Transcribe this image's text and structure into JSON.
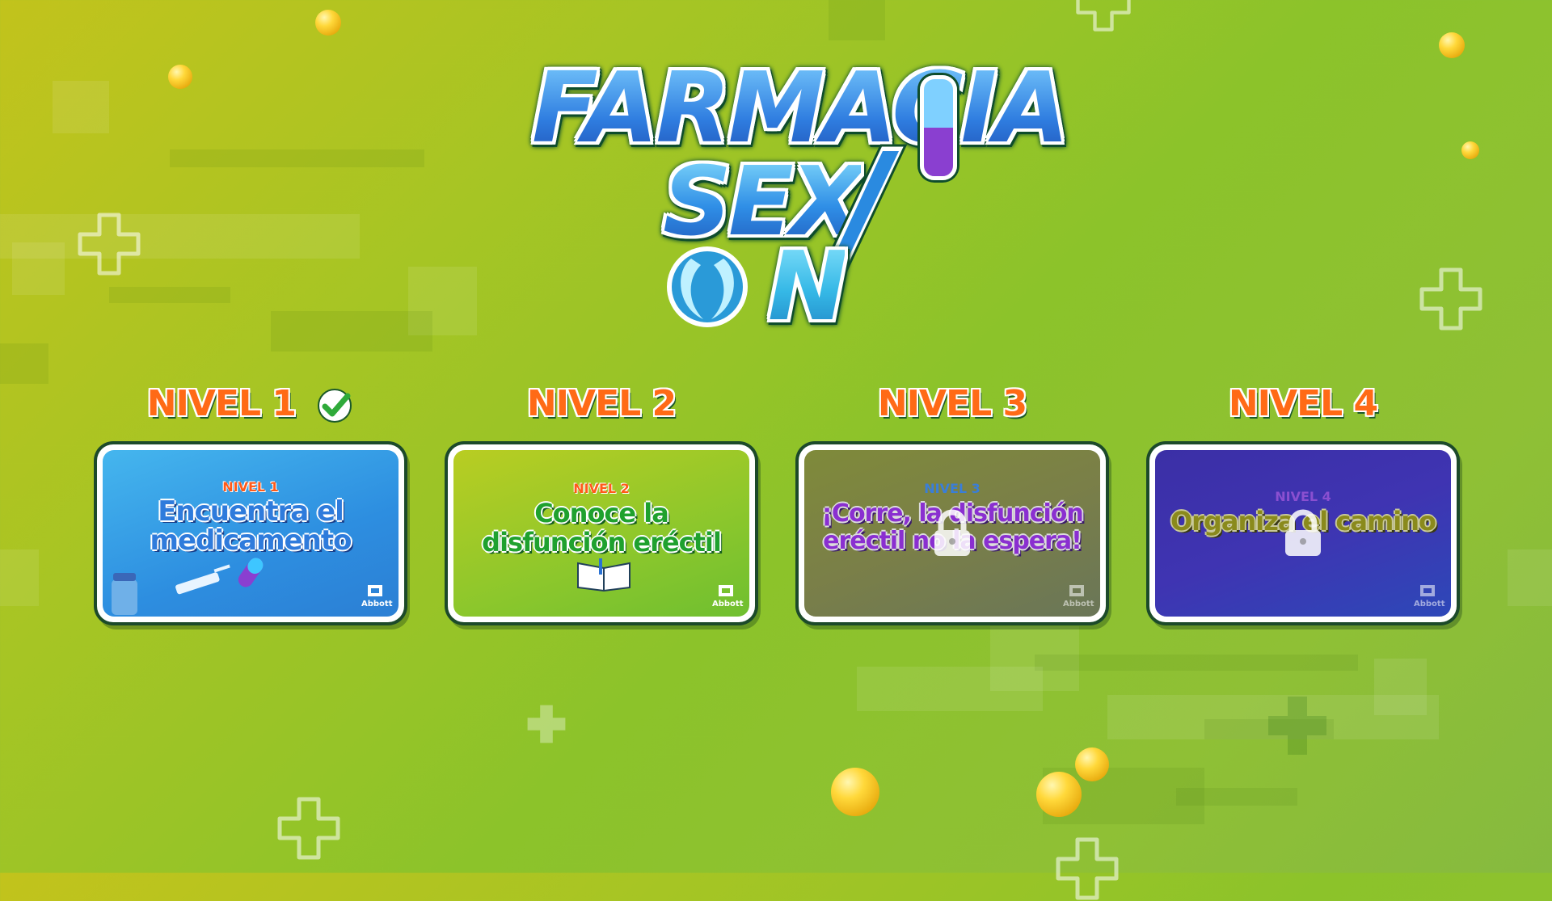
{
  "game": {
    "logo": {
      "line1": "FARMACIA",
      "line2": "SEX",
      "line3": "N"
    }
  },
  "levels": [
    {
      "heading": "NIVEL 1",
      "completed": true,
      "locked": false,
      "card_level": "NIVEL 1",
      "card_title": "Encuentra el medicamento",
      "brand": "Abbott"
    },
    {
      "heading": "NIVEL 2",
      "completed": false,
      "locked": false,
      "card_level": "NIVEL 2",
      "card_title": "Conoce la disfunción eréctil",
      "brand": "Abbott"
    },
    {
      "heading": "NIVEL 3",
      "completed": false,
      "locked": true,
      "card_level": "NIVEL 3",
      "card_title": "¡Corre, la disfunción eréctil no la espera!",
      "brand": "Abbott"
    },
    {
      "heading": "NIVEL 4",
      "completed": false,
      "locked": true,
      "card_level": "NIVEL 4",
      "card_title": "Organiza el camino",
      "brand": "Abbott"
    }
  ],
  "icons": {
    "completed": "checkmark-icon",
    "locked": "padlock-icon",
    "background": "medical-cross-icon",
    "decoration": "pill-bubble"
  },
  "colors": {
    "level_heading": "#ff6a16",
    "logo_blue": "#2f7de0",
    "check_green": "#2faa3a"
  }
}
